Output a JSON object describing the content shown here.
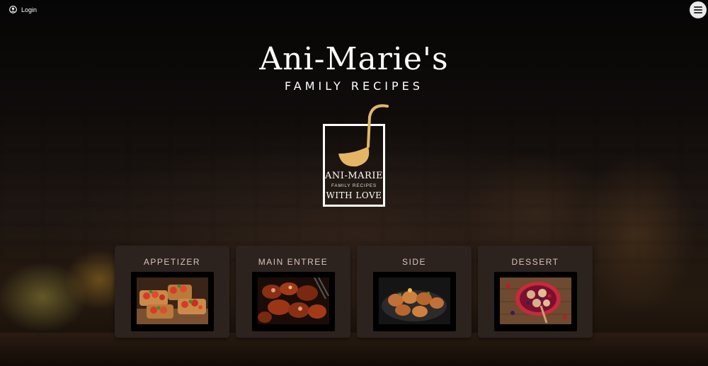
{
  "header": {
    "login_label": "Login",
    "login_icon": "user-circle-icon",
    "menu_icon": "hamburger-menu-icon"
  },
  "hero": {
    "title": "Ani-Marie's",
    "subtitle": "FAMILY RECIPES"
  },
  "logo": {
    "line1": "ANI-MARIE",
    "line2": "FAMILY RECIPES",
    "line3": "WITH LOVE",
    "icon": "ladle-icon",
    "accent_color": "#e3b565"
  },
  "categories": [
    {
      "label": "APPETIZER",
      "image": "bruschetta-photo"
    },
    {
      "label": "MAIN ENTREE",
      "image": "grilled-meat-photo"
    },
    {
      "label": "SIDE",
      "image": "roasted-potatoes-photo"
    },
    {
      "label": "DESSERT",
      "image": "berry-cobbler-photo"
    }
  ],
  "colors": {
    "card_bg": "#2c221e",
    "card_label": "#d9c6b8",
    "background": "#0e0b09"
  }
}
